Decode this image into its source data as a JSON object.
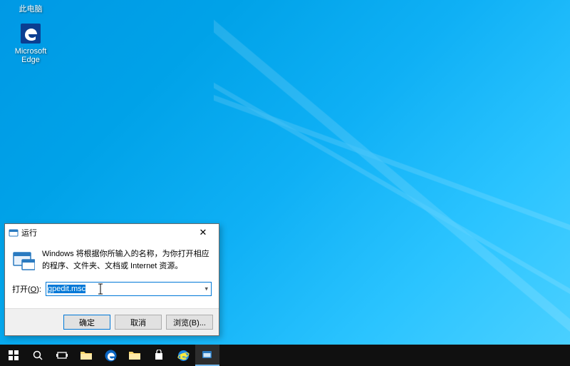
{
  "desktop": {
    "thispc_label": "此电脑",
    "edge_label": "Microsoft\nEdge"
  },
  "run_dialog": {
    "title": "运行",
    "description": "Windows 将根据你所输入的名称，为你打开相应的程序、文件夹、文档或 Internet 资源。",
    "open_label_pre": "打开(",
    "open_label_u": "O",
    "open_label_post": "):",
    "input_value": "gpedit.msc",
    "ok": "确定",
    "cancel": "取消",
    "browse": "浏览(B)..."
  }
}
